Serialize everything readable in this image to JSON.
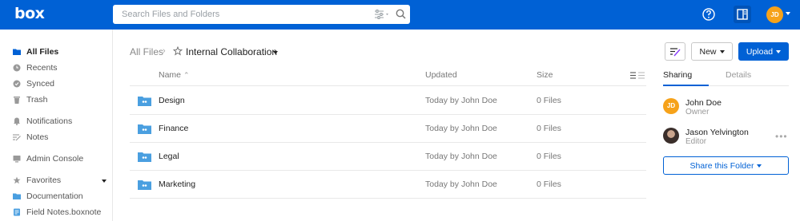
{
  "topbar": {
    "logo": "box",
    "search_placeholder": "Search Files and Folders",
    "avatar_initials": "JD",
    "icons": [
      "filter-icon",
      "search-icon",
      "help-icon",
      "panel-toggle-icon"
    ]
  },
  "sidebar": {
    "items": [
      {
        "label": "All Files",
        "icon": "folder-icon"
      },
      {
        "label": "Recents",
        "icon": "clock-icon"
      },
      {
        "label": "Synced",
        "icon": "sync-icon"
      },
      {
        "label": "Trash",
        "icon": "trash-icon"
      },
      {
        "label": "Notifications",
        "icon": "bell-icon"
      },
      {
        "label": "Notes",
        "icon": "notes-icon"
      },
      {
        "label": "Admin Console",
        "icon": "admin-icon"
      },
      {
        "label": "Favorites",
        "icon": "star-icon"
      },
      {
        "label": "Documentation",
        "icon": "folder-icon"
      },
      {
        "label": "Field Notes.boxnote",
        "icon": "boxnote-icon"
      }
    ]
  },
  "breadcrumb": {
    "root": "All Files",
    "current": "Internal Collaboration"
  },
  "toolbar": {
    "new_label": "New",
    "upload_label": "Upload"
  },
  "table": {
    "headers": {
      "name": "Name",
      "updated": "Updated",
      "size": "Size"
    },
    "rows": [
      {
        "name": "Design",
        "updated": "Today by John Doe",
        "size": "0 Files"
      },
      {
        "name": "Finance",
        "updated": "Today by John Doe",
        "size": "0 Files"
      },
      {
        "name": "Legal",
        "updated": "Today by John Doe",
        "size": "0 Files"
      },
      {
        "name": "Marketing",
        "updated": "Today by John Doe",
        "size": "0 Files"
      }
    ]
  },
  "panel": {
    "tabs": {
      "sharing": "Sharing",
      "details": "Details"
    },
    "collaborators": [
      {
        "initials": "JD",
        "name": "John Doe",
        "role": "Owner"
      },
      {
        "name": "Jason Yelvington",
        "role": "Editor"
      }
    ],
    "more": "•••",
    "share_label": "Share this Folder"
  },
  "colors": {
    "brand": "#0061d5",
    "avatar": "#f6a21a"
  }
}
